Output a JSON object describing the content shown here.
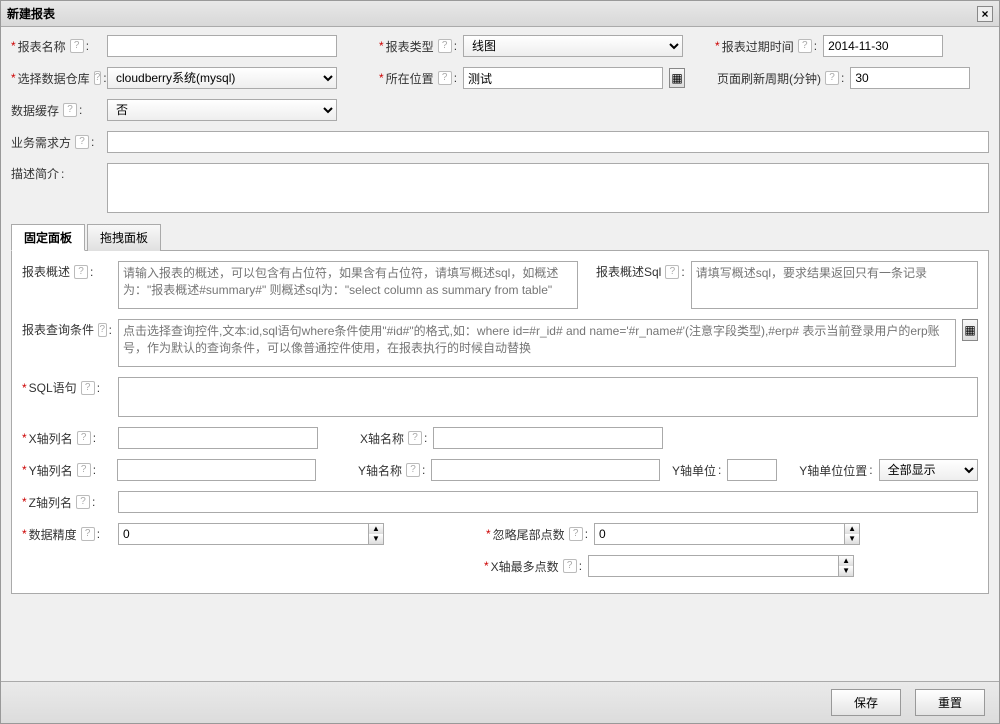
{
  "title": "新建报表",
  "labels": {
    "reportName": "报表名称",
    "reportType": "报表类型",
    "expireTime": "报表过期时间",
    "dataWarehouse": "选择数据仓库",
    "location": "所在位置",
    "refreshCycle": "页面刷新周期(分钟)",
    "dataCache": "数据缓存",
    "businessDemand": "业务需求方",
    "descIntro": "描述简介",
    "reportDesc": "报表概述",
    "reportDescSql": "报表概述Sql",
    "queryCond": "报表查询条件",
    "sqlStmt": "SQL语句",
    "xColName": "X轴列名",
    "xAxisName": "X轴名称",
    "yColName": "Y轴列名",
    "yAxisName": "Y轴名称",
    "yUnit": "Y轴单位",
    "yUnitPos": "Y轴单位位置",
    "zColName": "Z轴列名",
    "dataPrecision": "数据精度",
    "ignoreTail": "忽略尾部点数",
    "xMaxPoints": "X轴最多点数"
  },
  "values": {
    "reportType": "线图",
    "expireTime": "2014-11-30",
    "dataWarehouse": "cloudberry系统(mysql)",
    "location": "测试",
    "refreshCycle": "30",
    "dataCache": "否",
    "dataPrecision": "0",
    "ignoreTail": "0",
    "yUnitPos": "全部显示"
  },
  "placeholders": {
    "reportDesc": "请输入报表的概述，可以包含有占位符，如果含有占位符，请填写概述sql，如概述为：\"报表概述#summary#\" 则概述sql为：\"select column as summary from table\"",
    "reportDescSql": "请填写概述sql，要求结果返回只有一条记录",
    "queryCond": "点击选择查询控件,文本:id,sql语句where条件使用\"#id#\"的格式,如：where id=#r_id# and name='#r_name#'(注意字段类型),#erp# 表示当前登录用户的erp账号，作为默认的查询条件，可以像普通控件使用，在报表执行的时候自动替换"
  },
  "tabs": {
    "fixed": "固定面板",
    "drag": "拖拽面板"
  },
  "buttons": {
    "save": "保存",
    "reset": "重置"
  }
}
